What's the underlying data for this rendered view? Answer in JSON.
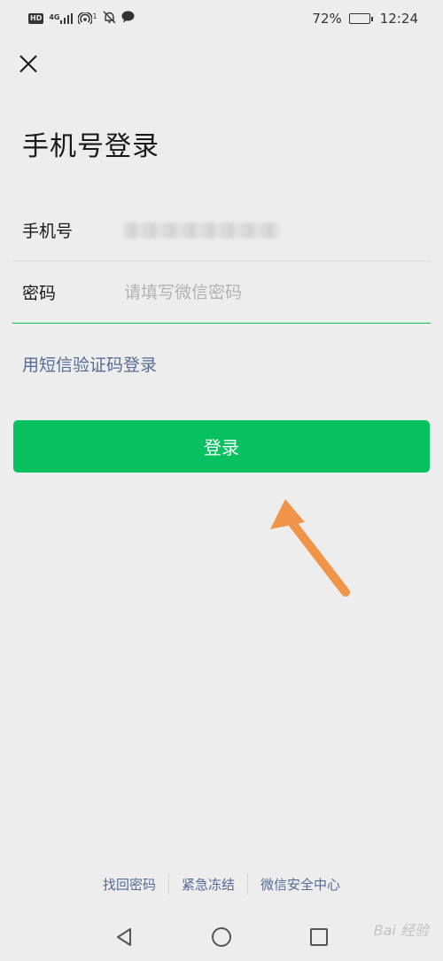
{
  "status_bar": {
    "network_badge": "HD",
    "network_type": "4G",
    "notification_count": "1",
    "battery_percent": "72%",
    "battery_level": 0.72,
    "time": "12:24"
  },
  "header": {
    "close_icon": "close-icon"
  },
  "title": "手机号登录",
  "form": {
    "phone_label": "手机号",
    "password_label": "密码",
    "password_placeholder": "请填写微信密码"
  },
  "sms_login_link": "用短信验证码登录",
  "login_button": "登录",
  "footer": {
    "links": [
      "找回密码",
      "紧急冻结",
      "微信安全中心"
    ]
  },
  "nav": {
    "back_icon": "triangle-back-icon",
    "home_icon": "circle-home-icon",
    "recents_icon": "square-recents-icon"
  },
  "watermark": "Bai 经验",
  "colors": {
    "background": "#ededed",
    "brand_green": "#07c160",
    "link_blue": "#576b95",
    "annotation_arrow": "#f0944a"
  }
}
